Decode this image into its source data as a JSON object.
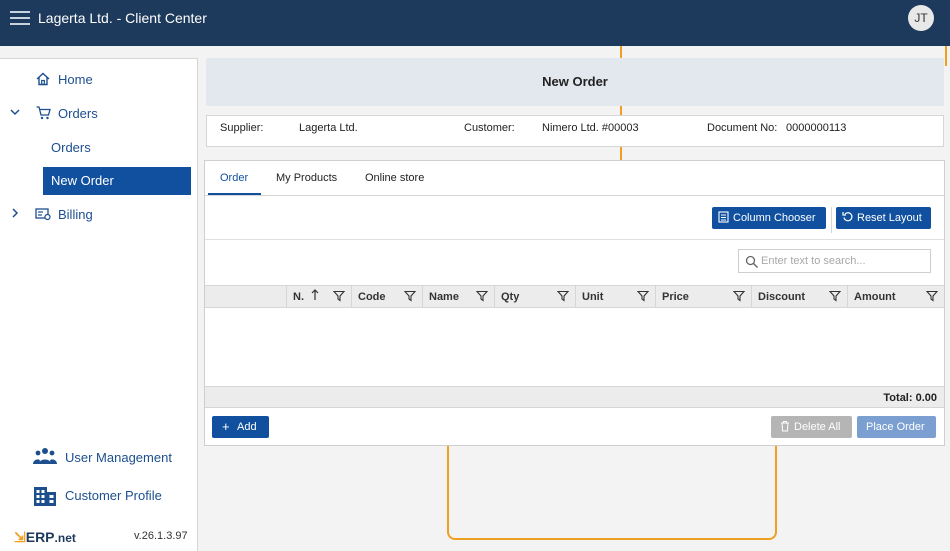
{
  "app": {
    "title": "Lagerta Ltd. - Client Center",
    "user_initials": "JT"
  },
  "sidebar": {
    "items": [
      {
        "label": "Home",
        "icon": "home-icon"
      },
      {
        "label": "Orders",
        "icon": "cart-icon",
        "expanded": true
      },
      {
        "label": "Orders"
      },
      {
        "label": "New Order",
        "active": true
      },
      {
        "label": "Billing",
        "icon": "billing-icon",
        "expanded": false
      }
    ],
    "bottom": [
      {
        "label": "User Management",
        "icon": "users-icon"
      },
      {
        "label": "Customer Profile",
        "icon": "building-icon"
      }
    ],
    "logo_prefix": "ERP",
    "logo_suffix": ".net",
    "version": "v.26.1.3.97"
  },
  "page": {
    "title": "New Order",
    "info": {
      "supplier_label": "Supplier:",
      "supplier_value": "Lagerta Ltd.",
      "customer_label": "Customer:",
      "customer_value": "Nimero Ltd. #00003",
      "document_label": "Document No:",
      "document_value": "0000000113"
    },
    "tabs": [
      {
        "label": "Order",
        "active": true
      },
      {
        "label": "My Products"
      },
      {
        "label": "Online store"
      }
    ],
    "toolbar": {
      "column_chooser": "Column Chooser",
      "reset_layout": "Reset Layout"
    },
    "search": {
      "placeholder": "Enter text to search..."
    },
    "grid": {
      "columns": [
        "N.",
        "Code",
        "Name",
        "Qty",
        "Unit",
        "Price",
        "Discount",
        "Amount"
      ],
      "sort_column": "N.",
      "rows": [],
      "total": "Total: 0.00"
    },
    "actions": {
      "add": "Add",
      "delete_all": "Delete All",
      "place_order": "Place Order"
    }
  },
  "colors": {
    "topbar": "#1d3a5c",
    "primary": "#10509f",
    "accent": "#f0a020",
    "disabled": "#b5b5b5",
    "place_order_disabled": "#7a9fd0"
  }
}
